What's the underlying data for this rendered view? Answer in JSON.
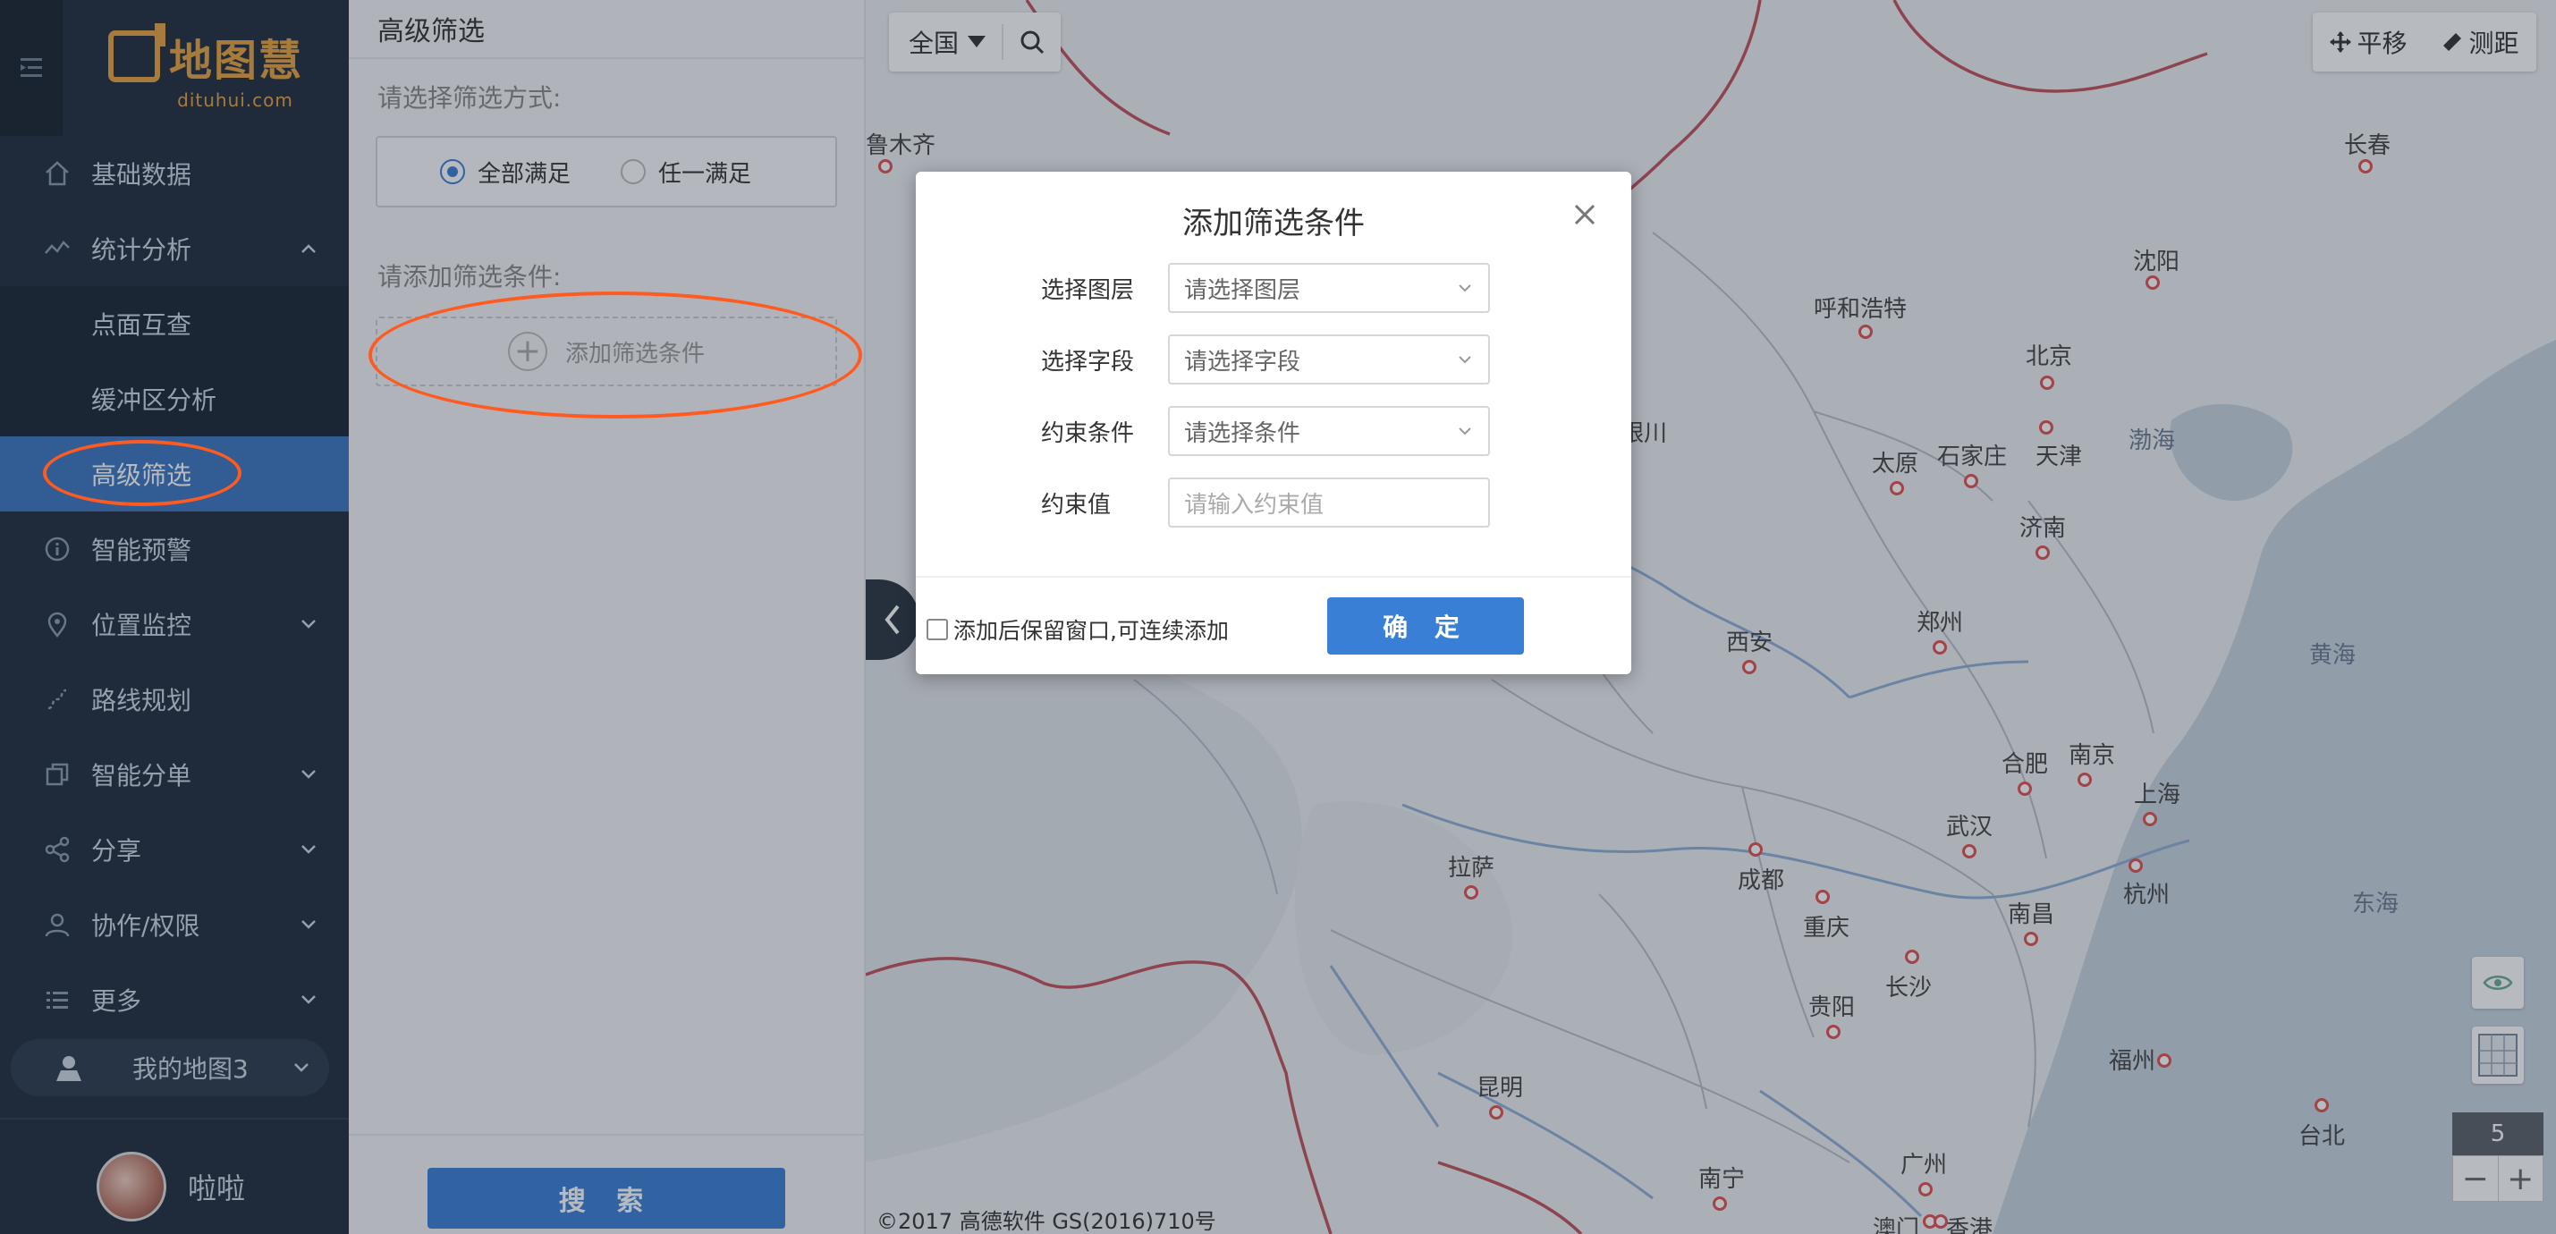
{
  "sidebar": {
    "logo": {
      "name": "地图慧",
      "domain": "dituhui.com"
    },
    "menu": [
      {
        "label": "基础数据",
        "icon": "home-icon"
      },
      {
        "label": "统计分析",
        "icon": "chart-line-icon",
        "expanded": true
      },
      {
        "label": "智能预警",
        "icon": "info-icon"
      },
      {
        "label": "位置监控",
        "icon": "location-pin-icon"
      },
      {
        "label": "路线规划",
        "icon": "route-icon"
      },
      {
        "label": "智能分单",
        "icon": "copy-icon"
      },
      {
        "label": "分享",
        "icon": "share-icon"
      },
      {
        "label": "协作/权限",
        "icon": "user-icon"
      },
      {
        "label": "更多",
        "icon": "list-icon"
      }
    ],
    "submenu": [
      {
        "label": "点面互查"
      },
      {
        "label": "缓冲区分析"
      },
      {
        "label": "高级筛选",
        "active": true
      }
    ],
    "my_map": "我的地图3",
    "user_name": "啦啦"
  },
  "panel": {
    "title": "高级筛选",
    "mode_label": "请选择筛选方式:",
    "mode_all": "全部满足",
    "mode_any": "任一满足",
    "conditions_label": "请添加筛选条件:",
    "add_condition": "添加筛选条件",
    "search_button": "搜 索"
  },
  "map": {
    "region": "全国",
    "pan": "平移",
    "measure": "测距",
    "zoom_level": "5",
    "copyright": "©2017 高德软件 GS(2016)710号",
    "cities": [
      {
        "name": "鲁木齐"
      },
      {
        "name": "长春"
      },
      {
        "name": "沈阳"
      },
      {
        "name": "呼和浩特"
      },
      {
        "name": "北京"
      },
      {
        "name": "银川"
      },
      {
        "name": "太原"
      },
      {
        "name": "石家庄"
      },
      {
        "name": "天津"
      },
      {
        "name": "济南"
      },
      {
        "name": "郑州"
      },
      {
        "name": "西安"
      },
      {
        "name": "合肥"
      },
      {
        "name": "南京"
      },
      {
        "name": "上海"
      },
      {
        "name": "武汉"
      },
      {
        "name": "杭州"
      },
      {
        "name": "拉萨"
      },
      {
        "name": "成都"
      },
      {
        "name": "重庆"
      },
      {
        "name": "长沙"
      },
      {
        "name": "南昌"
      },
      {
        "name": "贵阳"
      },
      {
        "name": "福州"
      },
      {
        "name": "昆明"
      },
      {
        "name": "台北"
      },
      {
        "name": "南宁"
      },
      {
        "name": "广州"
      },
      {
        "name": "澳门"
      },
      {
        "name": "香港"
      }
    ],
    "seas": [
      {
        "name": "渤海"
      },
      {
        "name": "黄海"
      },
      {
        "name": "东海"
      }
    ]
  },
  "modal": {
    "title": "添加筛选条件",
    "layer_label": "选择图层",
    "layer_placeholder": "请选择图层",
    "field_label": "选择字段",
    "field_placeholder": "请选择字段",
    "constraint_label": "约束条件",
    "constraint_placeholder": "请选择条件",
    "value_label": "约束值",
    "value_placeholder": "请输入约束值",
    "keep_open": "添加后保留窗口,可连续添加",
    "confirm": "确 定"
  },
  "colors": {
    "accent": "#3a7fd6",
    "sidebar_bg": "#1f2d3d",
    "highlight_annotation": "#ff5a1f",
    "logo": "#e8a23d"
  }
}
